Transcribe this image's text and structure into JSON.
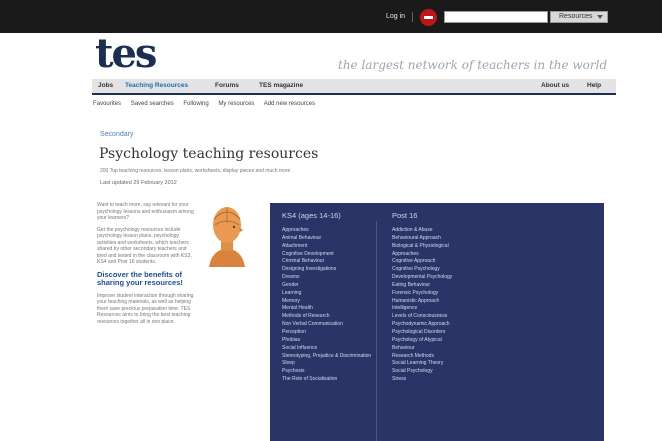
{
  "header": {
    "login_label": "Log in",
    "search_placeholder": "",
    "search_select_label": "Resources"
  },
  "brand": {
    "logo_text": "tes",
    "tagline": "the largest network of teachers in the world"
  },
  "nav": {
    "items": [
      "Jobs",
      "Teaching Resources",
      "Forums",
      "TES magazine",
      "About us",
      "Help"
    ]
  },
  "subnav": {
    "items": [
      "Favourites",
      "Saved searches",
      "Following",
      "My resources",
      "Add new resources"
    ]
  },
  "page": {
    "breadcrumb": "Secondary",
    "title": "Psychology teaching resources",
    "description": "200 Top teaching resources, lesson plans, worksheets, display pieces and much more",
    "updated": "Last updated 29 February 2012"
  },
  "sidebar": {
    "intro": "Want to teach more, say relevant for your psychology lessons and enthusiasm among your learners?",
    "body": "Get the psychology resources include psychology lesson plans, psychology activities and worksheets, which teachers shared by other secondary teachers and tried and tested in the classroom with KS3, KS4 and Post 16 students.",
    "discover_heading": "Discover the benefits of sharing your resources!",
    "outro": "Improve student interaction through sharing your teaching materials, as well as helping them save precious preparation time. TES Resources aims to bring the best teaching resources together all in one place."
  },
  "panel": {
    "col1_heading": "KS4 (ages 14-16)",
    "col1_items": [
      "Approaches",
      "Animal Behaviour",
      "Attachment",
      "Cognitive Development",
      "Criminal Behaviour",
      "Designing Investigations",
      "Dreams",
      "Gender",
      "Learning",
      "Memory",
      "Mental Health",
      "Methods of Research",
      "Non Verbal Communication",
      "Perception",
      "Phobias",
      "Social Influence",
      "Stereotyping, Prejudice & Discrimination",
      "Sleep",
      "Psychosis",
      "The Role of Socialisation"
    ],
    "col2_heading": "Post 16",
    "col2_items": [
      "Addiction & Abuse",
      "Behavioural Approach",
      "Biological & Physiological",
      "Approaches",
      "Cognitive Approach",
      "Cognitive Psychology",
      "Developmental Psychology",
      "Eating Behaviour",
      "Forensic Psychology",
      "Humanistic Approach",
      "Intelligence",
      "Levels of Consciousness",
      "Psychodynamic Approach",
      "Psychological Disorders",
      "Psychology of Atypical",
      "Behaviour",
      "Research Methods",
      "Social Learning Theory",
      "Social Psychology",
      "Stress"
    ]
  }
}
